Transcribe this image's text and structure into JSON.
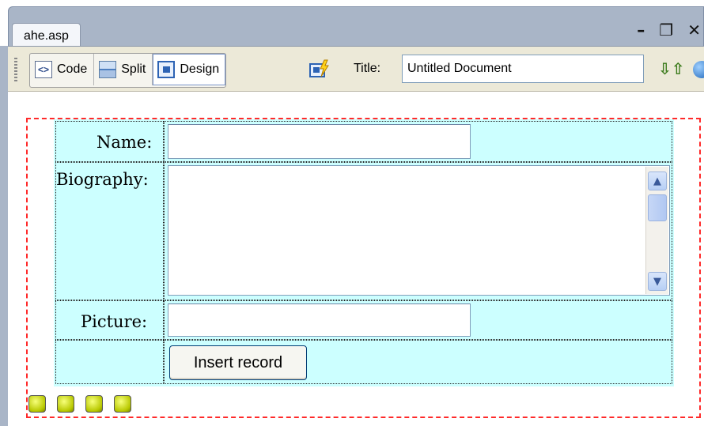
{
  "document_tab": {
    "filename": "ahe.asp"
  },
  "window_controls": {
    "minimize": "–",
    "restore": "❐",
    "close": "✕"
  },
  "toolbar": {
    "code_label": "Code",
    "split_label": "Split",
    "design_label": "Design",
    "title_label": "Title:",
    "title_value": "Untitled Document",
    "active_view": "Design"
  },
  "form": {
    "fields": [
      {
        "label": "Name:",
        "type": "text",
        "value": ""
      },
      {
        "label": "Biography:",
        "type": "textarea",
        "value": ""
      },
      {
        "label": "Picture:",
        "type": "text",
        "value": ""
      }
    ],
    "submit_label": "Insert record"
  },
  "server_behavior_icons": [
    "asp-icon",
    "asp-icon",
    "asp-icon",
    "asp-icon"
  ],
  "colors": {
    "form_border": "#ff2a2a",
    "table_bg": "#ccffff",
    "tab_bar": "#a9b5c7",
    "toolbar_bg": "#ece9d8"
  }
}
